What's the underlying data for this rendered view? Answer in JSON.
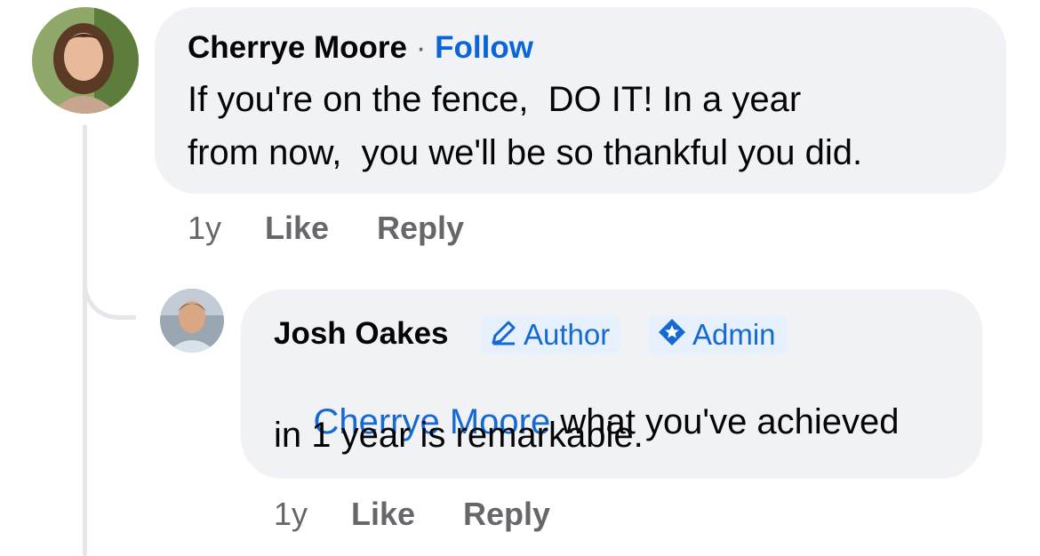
{
  "comment": {
    "author": "Cherrye Moore",
    "separator": "·",
    "follow_label": "Follow",
    "text_line1": "If you're on the fence,  DO IT! In a year",
    "text_line2": "from now,  you we'll be so thankful you did.",
    "time": "1y",
    "like_label": "Like",
    "reply_label": "Reply"
  },
  "reply": {
    "author": "Josh Oakes",
    "badges": {
      "author": "Author",
      "admin": "Admin"
    },
    "mention": "Cherrye Moore",
    "text_line1_rest": " what you've achieved",
    "text_line2": "in 1 year is remarkable.",
    "time": "1y",
    "like_label": "Like",
    "reply_label": "Reply"
  },
  "colors": {
    "bubble": "#f0f2f5",
    "link_blue": "#0a66d8",
    "badge_bg": "#e7f0fd",
    "meta_gray": "#65676b"
  },
  "icons": {
    "author_badge": "pencil-icon",
    "admin_badge": "shield-star-icon"
  }
}
